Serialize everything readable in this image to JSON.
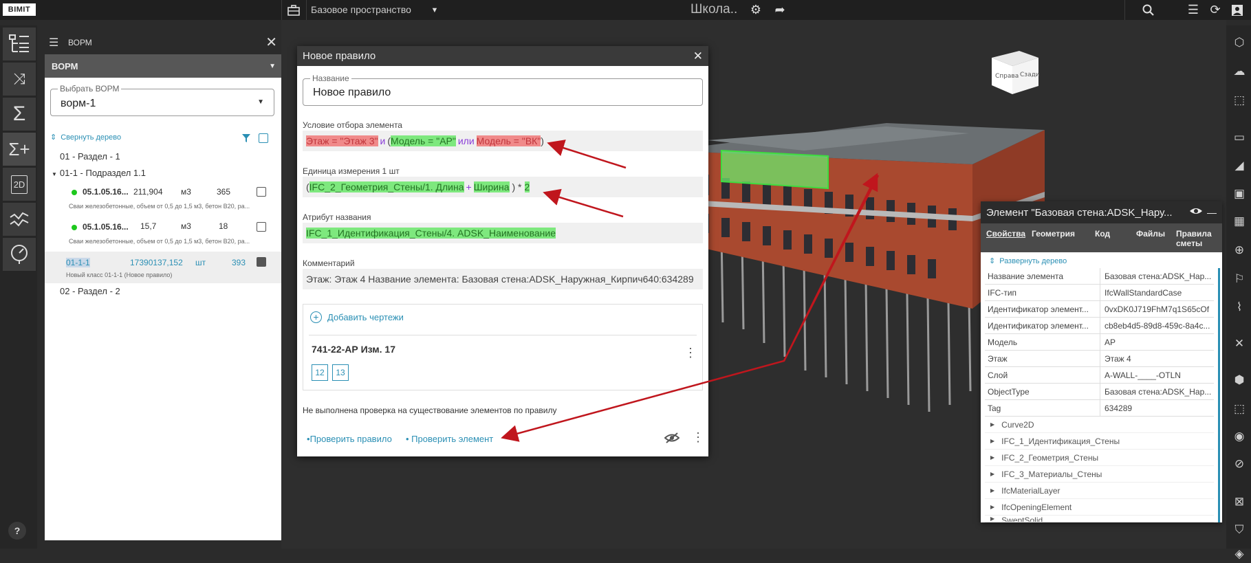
{
  "app": {
    "logo": "BIMIT",
    "space": "Базовое пространство",
    "project_title": "Школа.."
  },
  "vorm_panel": {
    "header": "ВОРМ",
    "section_title": "ВОРМ",
    "select_label": "Выбрать ВОРМ",
    "select_value": "ворм-1",
    "collapse_tree": "Свернуть дерево",
    "tree": {
      "section1": "01 - Раздел - 1",
      "subsection": "01-1 - Подраздел 1.1",
      "items": [
        {
          "code": "05.1.05.16...",
          "qty": "211,904",
          "unit": "м3",
          "count": "365",
          "desc": "Сваи железобетонные, объем от 0,5 до 1,5 м3, бетон B20, ра..."
        },
        {
          "code": "05.1.05.16...",
          "qty": "15,7",
          "unit": "м3",
          "count": "18",
          "desc": "Сваи железобетонные, объем от 0,5 до 1,5 м3, бетон B20, ра..."
        }
      ],
      "new_class": {
        "code": "01-1-1",
        "qty": "17390137,152",
        "unit": "шт",
        "count": "393",
        "desc": "Новый класс 01-1-1 (Новое правило)"
      },
      "section2": "02 - Раздел - 2"
    }
  },
  "dialog": {
    "title": "Новое правило",
    "name_label": "Название",
    "name_value": "Новое правило",
    "condition_label": "Условие отбора элемента",
    "condition": {
      "p1": "Этаж = \"Этаж 3\"",
      "and": "и",
      "p2": "Модель = \"АР\"",
      "or": "или",
      "p3": "Модель = \"ВК\""
    },
    "unit_label": "Единица измерения 1 шт",
    "unit_expr": {
      "p1": "IFC_2_Геометрия_Стены/1. Длина",
      "plus": "+",
      "p2": "Ширина",
      "tail": ") *",
      "p3": "2"
    },
    "attr_label": "Атрибут названия",
    "attr_value": "IFC_1_Идентификация_Стены/4. ADSK_Наименование",
    "comment_label": "Комментарий",
    "comment_value": "Этаж: Этаж 4 Название элемента: Базовая стена:ADSK_Наружная_Кирпич640:634289",
    "add_drawings": "Добавить чертежи",
    "drawing_title": "741-22-АР Изм. 17",
    "pages": [
      "12",
      "13"
    ],
    "status": "Не выполнена проверка на существование элементов по правилу",
    "check_rule": "Проверить правило",
    "check_element": "Проверить элемент"
  },
  "properties": {
    "title": "Элемент \"Базовая стена:ADSK_Нару...",
    "tabs": [
      "Свойства",
      "Геометрия",
      "Код",
      "Файлы",
      "Правила сметы"
    ],
    "expand_tree": "Развернуть дерево",
    "rows": [
      {
        "k": "Название элемента",
        "v": "Базовая стена:ADSK_Нар..."
      },
      {
        "k": "IFC-тип",
        "v": "IfcWallStandardCase"
      },
      {
        "k": "Идентификатор элемент...",
        "v": "0vxDK0J719FhM7q1S65cOf"
      },
      {
        "k": "Идентификатор элемент...",
        "v": "cb8eb4d5-89d8-459c-8a4c..."
      },
      {
        "k": "Модель",
        "v": "АР"
      },
      {
        "k": "Этаж",
        "v": "Этаж 4"
      },
      {
        "k": "Слой",
        "v": "A-WALL-____-OTLN"
      },
      {
        "k": "ObjectType",
        "v": "Базовая стена:ADSK_Нар..."
      },
      {
        "k": "Tag",
        "v": "634289"
      }
    ],
    "groups": [
      "Curve2D",
      "IFC_1_Идентификация_Стены",
      "IFC_2_Геометрия_Стены",
      "IFC_3_Материалы_Стены",
      "IfcMaterialLayer",
      "IfcOpeningElement",
      "SweptSolid"
    ]
  },
  "viewcube": {
    "left": "Справа",
    "front": "Сзади"
  }
}
